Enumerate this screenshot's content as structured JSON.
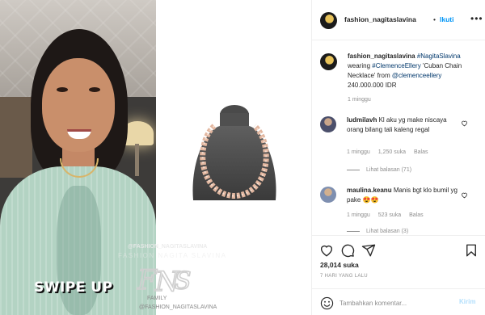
{
  "media": {
    "swipe_text": "SWIPE UP",
    "watermark_handle": "@FASHION_NAGITASLAVINA",
    "watermark_name": "FASHION NAGITA SLAVINA",
    "watermark_family": "FAMILY",
    "watermark_handle2": "@FASHION_NAGITASLAVINA"
  },
  "header": {
    "username": "fashion_nagitaslavina",
    "separator": "•",
    "follow_label": "Ikuti",
    "more_icon": "more-horizontal-icon"
  },
  "caption": {
    "username": "fashion_nagitaslavina",
    "tag1": "#NagitaSlavina",
    "text1": "wearing",
    "tag2": "#ClemenceEllery",
    "text2": "'Cuban Chain Necklace' from",
    "mention": "@clemenceellery",
    "price": "240.000.000 IDR",
    "time": "1 minggu"
  },
  "comments": [
    {
      "username": "ludmilavh",
      "text": "Kl aku yg make niscaya orang bilang tali kaleng regal",
      "time": "1 minggu",
      "likes": "1,250 suka",
      "reply": "Balas",
      "view_replies": "Lihat balasan (71)"
    },
    {
      "username": "maulina.keanu",
      "text": "Manis bgt klo bumil yg pake",
      "emoji": "😍😍",
      "time": "1 minggu",
      "likes": "523 suka",
      "reply": "Balas",
      "view_replies": "Lihat balasan (3)"
    }
  ],
  "actions": {
    "like_icon": "heart-icon",
    "comment_icon": "comment-icon",
    "share_icon": "share-icon",
    "save_icon": "bookmark-icon",
    "likes": "28,014 suka",
    "time_ago": "7 HARI YANG LALU"
  },
  "add_comment": {
    "placeholder": "Tambahkan komentar...",
    "post_label": "Kirim"
  },
  "colors": {
    "accent": "#0095f6",
    "link": "#00376b",
    "muted": "#8e8e8e",
    "post_disabled": "#b2dffc"
  }
}
